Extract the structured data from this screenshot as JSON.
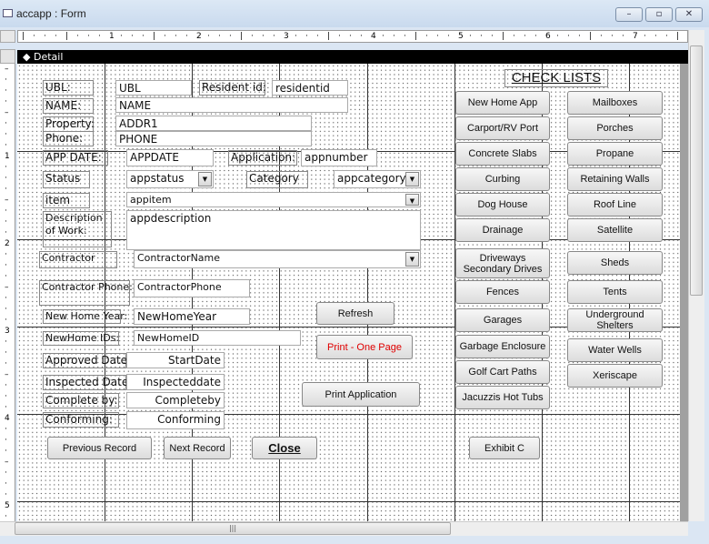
{
  "window": {
    "title": "accapp : Form",
    "minimize": "–",
    "restore": "▫",
    "close": "✕"
  },
  "section": {
    "label": "Detail",
    "icon": "section-arrow-icon"
  },
  "ruler": {
    "top": [
      "1",
      "2",
      "3",
      "4",
      "5",
      "6",
      "7"
    ],
    "left": [
      "1",
      "2",
      "3",
      "4",
      "5"
    ]
  },
  "fields": {
    "ubl_label": "UBL:",
    "ubl": "UBL",
    "resident_label": "Resident id:",
    "resident": "residentid",
    "name_label": "NAME:",
    "name": "NAME",
    "property_label": "Property:",
    "property": "ADDR1",
    "phone_label": "Phone:",
    "phone": "PHONE",
    "appdate_label": "APP DATE:",
    "appdate": "APPDATE",
    "application_label": "Application:",
    "application": "appnumber",
    "status_label": "Status",
    "status": "appstatus",
    "category_label": "Category",
    "category": "appcategory",
    "item_label": "item",
    "item": "appitem",
    "desc_label": "Description of Work:",
    "desc": "appdescription",
    "contractor_label": "Contractor",
    "contractor": "ContractorName",
    "cphone_label": "Contractor Phone:",
    "cphone": "ContractorPhone",
    "nhyear_label": "New Home Year:",
    "nhyear": "NewHomeYear",
    "nhid_label": "NewHome IDs:",
    "nhid": "NewHomeID",
    "approved_label": "Approved Date:",
    "approved": "StartDate",
    "inspected_label": "Inspected Date:",
    "inspected": "Inspecteddate",
    "complete_label": "Complete by:",
    "complete": "Completeby",
    "conforming_label": "Conforming:",
    "conforming": "Conforming"
  },
  "buttons": {
    "refresh": "Refresh",
    "print_one": "Print - One Page",
    "print_app": "Print Application",
    "prev": "Previous Record",
    "next": "Next Record",
    "close": "Close",
    "exhibit": "Exhibit C"
  },
  "checklists": {
    "title": "CHECK LISTS",
    "left": [
      "New Home App",
      "Carport/RV Port",
      "Concrete Slabs",
      "Curbing",
      "Dog House",
      "Drainage",
      "Driveways Secondary Drives",
      "Fences",
      "Garages",
      "Garbage Enclosure",
      "Golf Cart Paths",
      "Jacuzzis Hot Tubs"
    ],
    "right": [
      "Mailboxes",
      "Porches",
      "Propane",
      "Retaining Walls",
      "Roof Line",
      "Satellite",
      "Sheds",
      "Tents",
      "Underground Shelters",
      "Water Wells",
      "Xeriscape"
    ]
  },
  "colors": {
    "print_one_text": "#e00000"
  }
}
